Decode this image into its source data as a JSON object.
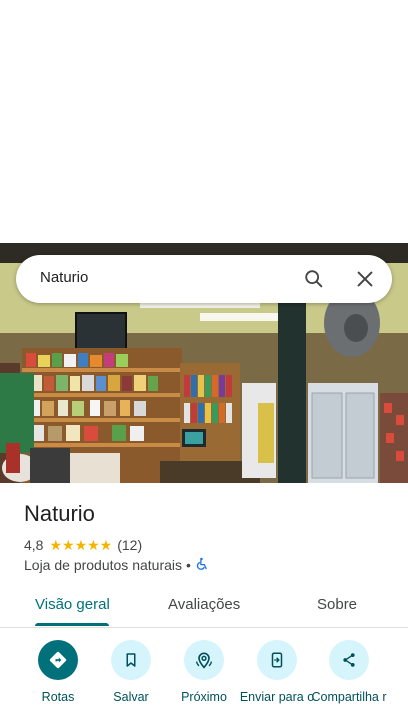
{
  "search": {
    "query": "Naturio"
  },
  "place": {
    "name": "Naturio",
    "rating": "4,8",
    "stars": "★★★★★",
    "reviews": "(12)",
    "category": "Loja de produtos naturais",
    "separator": "•",
    "accessible_icon": "wheelchair-icon"
  },
  "tabs": [
    {
      "label": "Visão geral",
      "active": true
    },
    {
      "label": "Avaliações",
      "active": false
    },
    {
      "label": "Sobre",
      "active": false
    }
  ],
  "actions": [
    {
      "label": "Rotas",
      "icon": "directions-icon"
    },
    {
      "label": "Salvar",
      "icon": "bookmark-icon"
    },
    {
      "label": "Próximo",
      "icon": "nearby-icon"
    },
    {
      "label": "Enviar para o",
      "icon": "send-to-phone-icon"
    },
    {
      "label": "Compartilha r",
      "icon": "share-icon"
    }
  ],
  "colors": {
    "accent": "#00717a",
    "chip": "#d6f4fb",
    "star": "#f4b400"
  }
}
